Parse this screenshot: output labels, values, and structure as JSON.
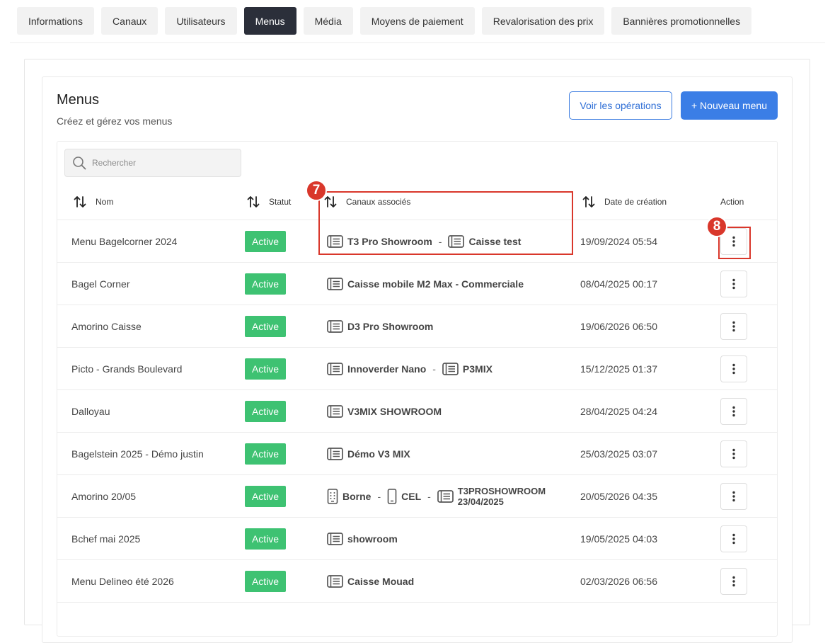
{
  "tabs": [
    {
      "label": "Informations",
      "active": false
    },
    {
      "label": "Canaux",
      "active": false
    },
    {
      "label": "Utilisateurs",
      "active": false
    },
    {
      "label": "Menus",
      "active": true
    },
    {
      "label": "Média",
      "active": false
    },
    {
      "label": "Moyens de paiement",
      "active": false
    },
    {
      "label": "Revalorisation des prix",
      "active": false
    },
    {
      "label": "Bannières promotionnelles",
      "active": false
    }
  ],
  "header": {
    "title": "Menus",
    "subtitle": "Créez et gérez vos menus",
    "view_ops_label": "Voir les opérations",
    "new_menu_label": "+ Nouveau menu"
  },
  "search": {
    "placeholder": "Rechercher"
  },
  "columns": {
    "name": "Nom",
    "status": "Statut",
    "channels": "Canaux associés",
    "date": "Date de création",
    "action": "Action"
  },
  "markers": {
    "channels": "7",
    "action": "8"
  },
  "colors": {
    "active_badge": "#3ec272",
    "primary": "#3b7ee6",
    "highlight": "#d9372b",
    "active_tab": "#2b2f3a"
  },
  "rows": [
    {
      "name": "Menu Bagelcorner 2024",
      "status": "Active",
      "date": "19/09/2024 05:54",
      "channels": [
        {
          "icon": "pos-terminal-icon",
          "label": "T3 Pro Showroom"
        },
        {
          "icon": "pos-terminal-icon",
          "label": "Caisse test"
        }
      ]
    },
    {
      "name": "Bagel Corner",
      "status": "Active",
      "date": "08/04/2025 00:17",
      "channels": [
        {
          "icon": "pos-terminal-icon",
          "label": "Caisse mobile M2 Max - Commerciale"
        }
      ]
    },
    {
      "name": "Amorino Caisse",
      "status": "Active",
      "date": "19/06/2026 06:50",
      "channels": [
        {
          "icon": "pos-terminal-icon",
          "label": "D3 Pro Showroom"
        }
      ]
    },
    {
      "name": "Picto - Grands Boulevard",
      "status": "Active",
      "date": "15/12/2025 01:37",
      "channels": [
        {
          "icon": "pos-terminal-icon",
          "label": "Innoverder Nano"
        },
        {
          "icon": "pos-terminal-icon",
          "label": "P3MIX"
        }
      ]
    },
    {
      "name": "Dalloyau",
      "status": "Active",
      "date": "28/04/2025 04:24",
      "channels": [
        {
          "icon": "pos-terminal-icon",
          "label": "V3MIX SHOWROOM"
        }
      ]
    },
    {
      "name": "Bagelstein 2025 - Démo justin",
      "status": "Active",
      "date": "25/03/2025 03:07",
      "channels": [
        {
          "icon": "pos-terminal-icon",
          "label": "Démo V3 MIX"
        }
      ]
    },
    {
      "name": "Amorino 20/05",
      "status": "Active",
      "date": "20/05/2026 04:35",
      "channels": [
        {
          "icon": "kiosk-icon",
          "label": "Borne"
        },
        {
          "icon": "mobile-icon",
          "label": "CEL"
        },
        {
          "icon": "pos-terminal-icon",
          "label": "T3PROSHOWROOM",
          "label2": "23/04/2025"
        }
      ]
    },
    {
      "name": "Bchef mai 2025",
      "status": "Active",
      "date": "19/05/2025 04:03",
      "channels": [
        {
          "icon": "pos-terminal-icon",
          "label": "showroom"
        }
      ]
    },
    {
      "name": "Menu Delineo été 2026",
      "status": "Active",
      "date": "02/03/2026 06:56",
      "channels": [
        {
          "icon": "pos-terminal-icon",
          "label": "Caisse Mouad"
        }
      ]
    }
  ]
}
